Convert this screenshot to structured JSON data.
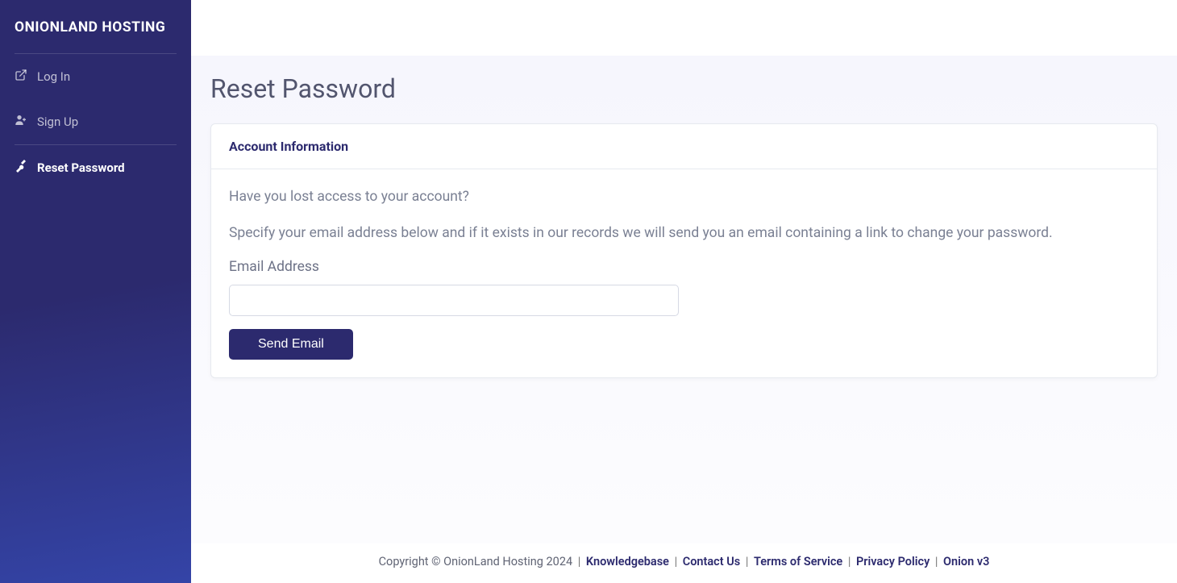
{
  "sidebar": {
    "logo": "ONIONLAND HOSTING",
    "items": [
      {
        "label": "Log In",
        "active": false
      },
      {
        "label": "Sign Up",
        "active": false
      },
      {
        "label": "Reset Password",
        "active": true
      }
    ]
  },
  "page": {
    "title": "Reset Password"
  },
  "card": {
    "header": "Account Information",
    "body": {
      "lead1": "Have you lost access to your account?",
      "lead2": "Specify your email address below and if it exists in our records we will send you an email containing a link to change your password.",
      "email_label": "Email Address",
      "email_value": "",
      "submit_label": "Send Email"
    }
  },
  "footer": {
    "copyright": "Copyright © OnionLand Hosting 2024",
    "links": {
      "knowledgebase": "Knowledgebase",
      "contact": "Contact Us",
      "tos": "Terms of Service",
      "privacy": "Privacy Policy",
      "onion": "Onion v3"
    }
  }
}
